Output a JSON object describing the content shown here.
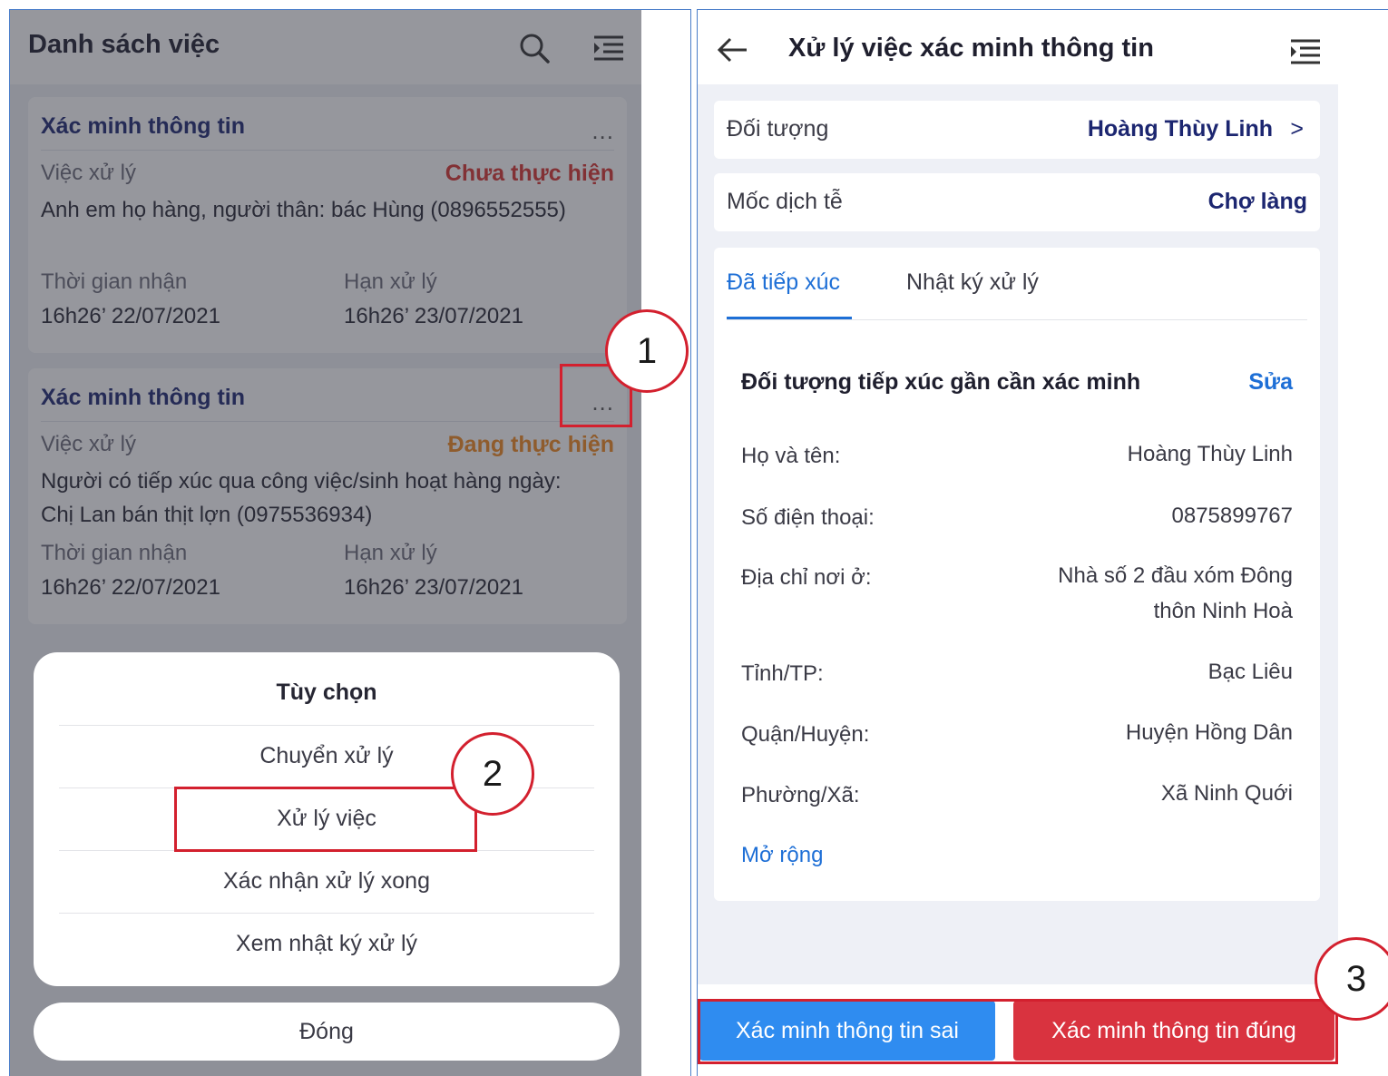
{
  "left": {
    "title": "Danh sách việc",
    "cards": [
      {
        "title": "Xác minh thông tin",
        "dots": "...",
        "task_label": "Việc xử lý",
        "status": "Chưa thực hiện",
        "status_color": "#d6332e",
        "desc": "Anh em họ hàng, người thân: bác Hùng (0896552555)",
        "received_label": "Thời gian nhận",
        "received_value": "16h26’ 22/07/2021",
        "deadline_label": "Hạn xử lý",
        "deadline_value": "16h26’ 23/07/2021"
      },
      {
        "title": "Xác minh thông tin",
        "dots": "...",
        "task_label": "Việc xử lý",
        "status": "Đang thực hiện",
        "status_color": "#f0891e",
        "desc": "Người có tiếp xúc qua công việc/sinh hoạt hàng ngày: Chị Lan bán thịt lợn (0975536934)",
        "received_label": "Thời gian nhận",
        "received_value": "16h26’ 22/07/2021",
        "deadline_label": "Hạn xử lý",
        "deadline_value": "16h26’ 23/07/2021"
      }
    ],
    "sheet": {
      "title": "Tùy chọn",
      "items": [
        "Chuyển xử lý",
        "Xử lý việc",
        "Xác nhận xử lý xong",
        "Xem nhật ký xử lý"
      ],
      "close": "Đóng"
    }
  },
  "annotations": {
    "step1": "1",
    "step2": "2",
    "step3": "3"
  },
  "right": {
    "title": "Xử lý việc xác minh thông tin",
    "subject_label": "Đối tượng",
    "subject_value": "Hoàng Thùy Linh",
    "subject_chevron": ">",
    "milestone_label": "Mốc dịch tễ",
    "milestone_value": "Chợ làng",
    "tabs": [
      "Đã tiếp xúc",
      "Nhật ký xử lý"
    ],
    "section_title": "Đối tượng tiếp xúc gần cần xác minh",
    "edit_label": "Sửa",
    "fields": {
      "name_label": "Họ và tên:",
      "name_value": "Hoàng Thùy Linh",
      "phone_label": "Số điện thoại:",
      "phone_value": "0875899767",
      "address_label": "Địa chỉ nơi ở:",
      "address_value_1": "Nhà số 2 đầu xóm Đông",
      "address_value_2": "thôn Ninh Hoà",
      "province_label": "Tỉnh/TP:",
      "province_value": "Bạc Liêu",
      "district_label": "Quận/Huyện:",
      "district_value": "Huyện Hồng Dân",
      "ward_label": "Phường/Xã:",
      "ward_value": "Xã Ninh Quới"
    },
    "more_label": "Mở rộng",
    "btn_false": "Xác minh thông tin sai",
    "btn_true": "Xác minh thông tin đúng"
  },
  "colors": {
    "accent_blue": "#1e6fd6",
    "title_navy": "#1c2670",
    "annotation_red": "#d3202e"
  }
}
